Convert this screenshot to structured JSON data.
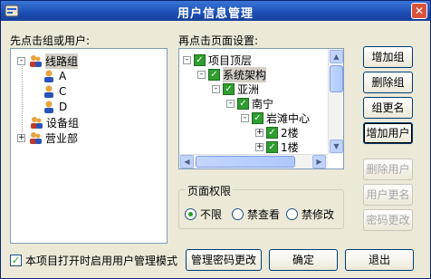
{
  "window": {
    "title": "用户信息管理"
  },
  "left": {
    "label": "先点击组或用户:",
    "tree": [
      {
        "label": "线路组",
        "expand": "-"
      },
      {
        "label": "A"
      },
      {
        "label": "C"
      },
      {
        "label": "D"
      },
      {
        "label": "设备组"
      },
      {
        "label": "营业部",
        "expand": "+"
      }
    ]
  },
  "right": {
    "label": "再点击页面设置:",
    "tree": [
      {
        "label": "项目顶层",
        "expand": "-"
      },
      {
        "label": "系统架构",
        "expand": "-"
      },
      {
        "label": "亚洲",
        "expand": "-"
      },
      {
        "label": "南宁",
        "expand": "-"
      },
      {
        "label": "岩滩中心",
        "expand": "-"
      },
      {
        "label": "2楼",
        "expand": "+"
      },
      {
        "label": "1楼",
        "expand": "+"
      }
    ]
  },
  "buttons": {
    "add_group": "增加组",
    "delete_group": "删除组",
    "rename_group": "组更名",
    "add_user": "增加用户",
    "delete_user": "删除用户",
    "rename_user": "用户更名",
    "change_password": "密码更改",
    "admin_password": "管理密码更改",
    "ok": "确定",
    "exit": "退出"
  },
  "permissions": {
    "title": "页面权限",
    "options": [
      "不限",
      "禁查看",
      "禁修改"
    ],
    "selected": "不限"
  },
  "enable_mode": {
    "label": "本项目打开时启用用户管理模式",
    "checked": true
  }
}
